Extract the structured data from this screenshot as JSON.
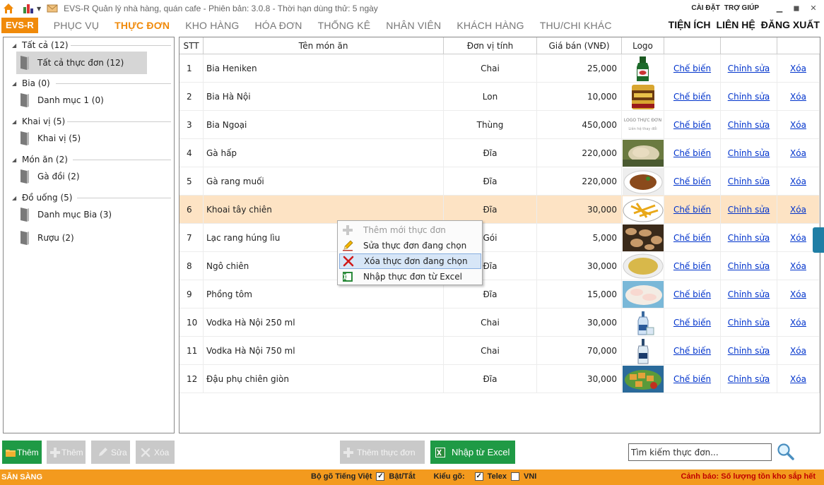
{
  "titlebar": {
    "title": "EVS-R Quản lý nhà hàng, quán cafe - Phiên bản: 3.0.8 - Thời hạn dùng thử: 5 ngày",
    "settings": "CÀI ĐẶT",
    "help": "TRỢ GIÚP"
  },
  "menu": {
    "brand": "EVS-R",
    "items": [
      "PHỤC VỤ",
      "THỰC ĐƠN",
      "KHO HÀNG",
      "HÓA ĐƠN",
      "THỐNG KÊ",
      "NHÂN VIÊN",
      "KHÁCH HÀNG",
      "THU/CHI KHÁC"
    ],
    "active_index": 1,
    "right": [
      "TIỆN ÍCH",
      "LIÊN HỆ",
      "ĐĂNG XUẤT"
    ]
  },
  "tree": {
    "groups": [
      {
        "label": "Tất cả (12)",
        "items": [
          {
            "label": "Tất cả thực đơn (12)",
            "selected": true
          }
        ]
      },
      {
        "label": "Bia (0)",
        "items": [
          {
            "label": "Danh mục 1 (0)"
          }
        ]
      },
      {
        "label": "Khai vị (5)",
        "items": [
          {
            "label": "Khai vị (5)"
          }
        ]
      },
      {
        "label": "Món ăn (2)",
        "items": [
          {
            "label": "Gà đồi (2)"
          }
        ]
      },
      {
        "label": "Đồ uống (5)",
        "items": [
          {
            "label": "Danh mục Bia (3)"
          },
          {
            "label": "Rượu (2)"
          }
        ]
      }
    ]
  },
  "grid": {
    "columns": [
      "STT",
      "Tên món ăn",
      "Đơn vị tính",
      "Giá bán (VNĐ)",
      "Logo",
      "",
      "",
      ""
    ],
    "selected_row": 6,
    "rows": [
      {
        "stt": "1",
        "name": "Bia Heniken",
        "unit": "Chai",
        "price": "25,000",
        "logo": "beer-bottle",
        "process": "Chế biến",
        "edit": "Chỉnh sửa",
        "delete": "Xóa"
      },
      {
        "stt": "2",
        "name": "Bia Hà Nội",
        "unit": "Lon",
        "price": "10,000",
        "logo": "beer-can",
        "process": "Chế biến",
        "edit": "Chỉnh sửa",
        "delete": "Xóa"
      },
      {
        "stt": "3",
        "name": "Bia Ngoại",
        "unit": "Thùng",
        "price": "450,000",
        "logo": "logo-placeholder",
        "logo_text": "LOGO THỰC ĐƠN",
        "logo_sub": "Liên hệ thay đổi",
        "process": "Chế biến",
        "edit": "Chỉnh sửa",
        "delete": "Xóa"
      },
      {
        "stt": "4",
        "name": "Gà hấp",
        "unit": "Đĩa",
        "price": "220,000",
        "logo": "steamed-chicken",
        "process": "Chế biến",
        "edit": "Chỉnh sửa",
        "delete": "Xóa"
      },
      {
        "stt": "5",
        "name": "Gà rang muối",
        "unit": "Đĩa",
        "price": "220,000",
        "logo": "salt-chicken",
        "process": "Chế biến",
        "edit": "Chỉnh sửa",
        "delete": "Xóa"
      },
      {
        "stt": "6",
        "name": "Khoai tây chiên",
        "unit": "Đĩa",
        "price": "30,000",
        "logo": "french-fries",
        "process": "Chế biến",
        "edit": "Chỉnh sửa",
        "delete": "Xóa"
      },
      {
        "stt": "7",
        "name": "Lạc rang húng lìu",
        "unit": "Gói",
        "price": "5,000",
        "logo": "peanuts",
        "process": "Chế biến",
        "edit": "Chỉnh sửa",
        "delete": "Xóa"
      },
      {
        "stt": "8",
        "name": "Ngô chiên",
        "unit": "Đĩa",
        "price": "30,000",
        "logo": "fried-corn",
        "process": "Chế biến",
        "edit": "Chỉnh sửa",
        "delete": "Xóa"
      },
      {
        "stt": "9",
        "name": "Phồng tôm",
        "unit": "Đĩa",
        "price": "15,000",
        "logo": "shrimp-chips",
        "process": "Chế biến",
        "edit": "Chỉnh sửa",
        "delete": "Xóa"
      },
      {
        "stt": "10",
        "name": "Vodka Hà Nội 250 ml",
        "unit": "Chai",
        "price": "30,000",
        "logo": "vodka-small",
        "process": "Chế biến",
        "edit": "Chỉnh sửa",
        "delete": "Xóa"
      },
      {
        "stt": "11",
        "name": "Vodka Hà Nội 750 ml",
        "unit": "Chai",
        "price": "70,000",
        "logo": "vodka-large",
        "process": "Chế biến",
        "edit": "Chỉnh sửa",
        "delete": "Xóa"
      },
      {
        "stt": "12",
        "name": "Đậu phụ chiên giòn",
        "unit": "Đĩa",
        "price": "30,000",
        "logo": "fried-tofu",
        "process": "Chế biến",
        "edit": "Chỉnh sửa",
        "delete": "Xóa"
      }
    ]
  },
  "context_menu": {
    "items": [
      {
        "label": "Thêm mới thực đơn",
        "icon": "plus-icon",
        "disabled": true
      },
      {
        "label": "Sửa thực đơn đang chọn",
        "icon": "pencil-icon"
      },
      {
        "label": "Xóa thực đơn đang chọn",
        "icon": "delete-x-icon",
        "hover": true
      },
      {
        "label": "Nhập thực đơn từ Excel",
        "icon": "excel-icon"
      }
    ]
  },
  "bottom": {
    "add": "Thêm",
    "add2": "Thêm",
    "edit": "Sửa",
    "delete": "Xóa",
    "add_menu": "Thêm thực đơn",
    "import_excel": "Nhập từ Excel",
    "search_placeholder": "Tìm kiếm thực đơn..."
  },
  "status": {
    "ready": "SẴN SÀNG",
    "vn_typing": "Bộ gõ Tiếng Việt",
    "onoff": "Bật/Tắt",
    "typing_mode": "Kiểu gõ:",
    "telex": "Telex",
    "vni": "VNI",
    "warning": "Cảnh báo: Số lượng tồn kho sắp hết"
  },
  "colors": {
    "accent": "#f08a0a",
    "green": "#1f9a45",
    "selected_row": "#fde3c4",
    "link": "#0033cc",
    "warning": "#c00000"
  }
}
